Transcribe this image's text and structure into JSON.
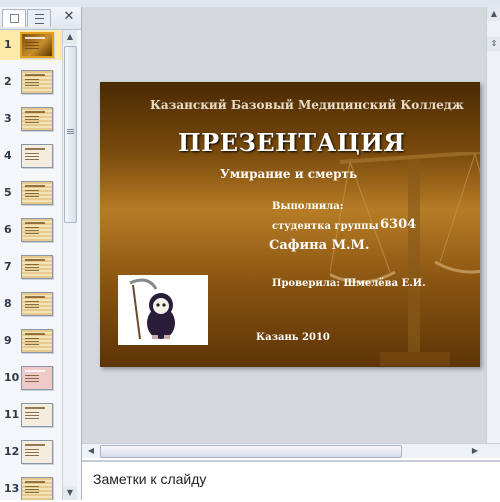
{
  "panel": {
    "close_glyph": "✕",
    "slides": [
      {
        "number": "1",
        "style": "brown",
        "active": true
      },
      {
        "number": "2",
        "style": "tan",
        "active": false
      },
      {
        "number": "3",
        "style": "tan",
        "active": false
      },
      {
        "number": "4",
        "style": "light",
        "active": false
      },
      {
        "number": "5",
        "style": "tan",
        "active": false
      },
      {
        "number": "6",
        "style": "tan",
        "active": false
      },
      {
        "number": "7",
        "style": "tan",
        "active": false
      },
      {
        "number": "8",
        "style": "tan",
        "active": false
      },
      {
        "number": "9",
        "style": "tan",
        "active": false
      },
      {
        "number": "10",
        "style": "pink",
        "active": false
      },
      {
        "number": "11",
        "style": "light",
        "active": false
      },
      {
        "number": "12",
        "style": "light",
        "active": false
      },
      {
        "number": "13",
        "style": "tan",
        "active": false
      }
    ]
  },
  "slide": {
    "college": "Казанский Базовый Медицинский Колледж",
    "title": "ПРЕЗЕНТАЦИЯ",
    "subtitle": "Умирание и смерть",
    "author_label": "Выполнила:",
    "group_label": "студентка группы",
    "group_number": "6304",
    "author_name": "Сафина М.М.",
    "checked_by": "Проверила:  Шмелёва Е.И.",
    "city_year": "Казань 2010"
  },
  "notes": {
    "placeholder": "Заметки к слайду"
  },
  "colors": {
    "slide_dark": "#4a2a03",
    "slide_light": "#b67c25",
    "active_thumb": "#fde9a8",
    "active_border": "#e3a21a"
  }
}
